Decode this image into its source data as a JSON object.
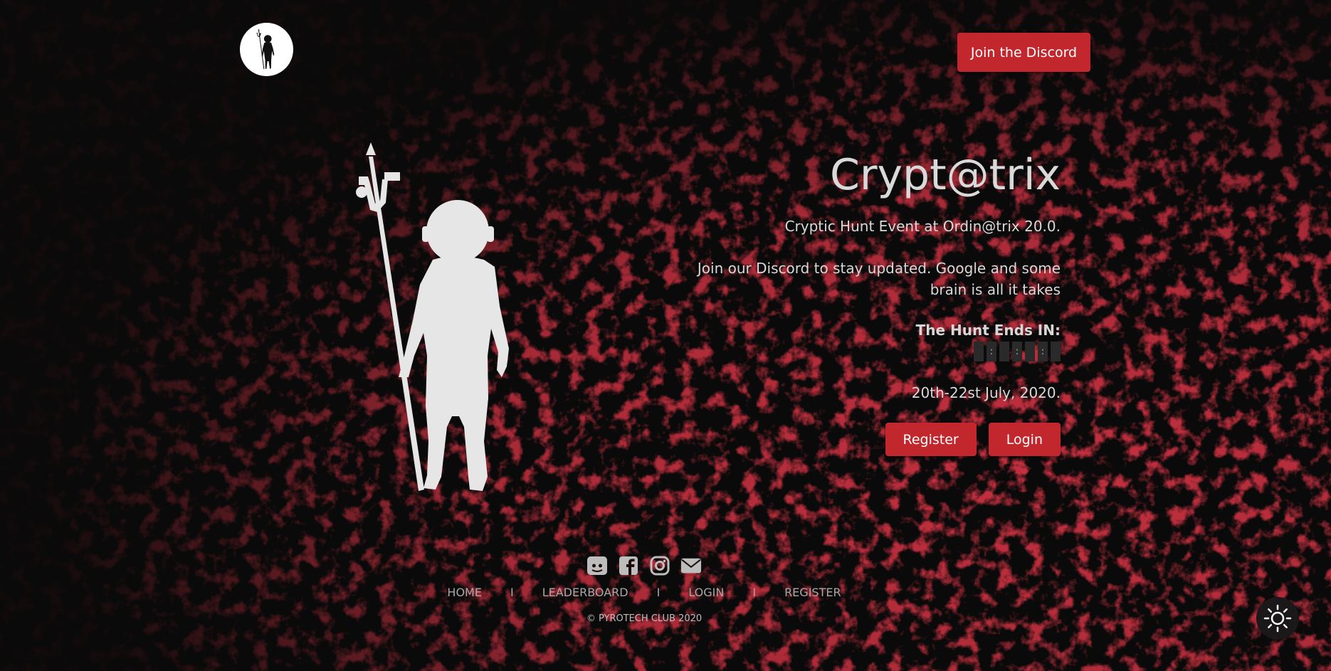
{
  "header": {
    "discord_button": "Join the Discord"
  },
  "hero": {
    "title": "Crypt@trix",
    "subtitle": "Cryptic Hunt Event at Ordin@trix 20.0.",
    "blurb": "Join our Discord to stay updated. Google and some brain is all it takes",
    "ends_label": "The Hunt Ends IN:",
    "countdown_separator": ":",
    "dates": "20th-22st July, 2020.",
    "register_label": "Register",
    "login_label": "Login"
  },
  "footer": {
    "nav": {
      "home": "HOME",
      "leaderboard": "LEADERBOARD",
      "login": "LOGIN",
      "register": "REGISTER",
      "separator": "I"
    },
    "copyright": "© PYROTECH CLUB 2020"
  },
  "colors": {
    "accent": "#c1272d",
    "background": "#0b0a0a",
    "splatter": "#8a0f12",
    "text": "#d8d8d8"
  },
  "icons": {
    "logo": "astronaut-trident-logo-icon",
    "socials": [
      "discord-icon",
      "facebook-icon",
      "instagram-icon",
      "mail-icon"
    ],
    "theme": "sun-icon"
  }
}
